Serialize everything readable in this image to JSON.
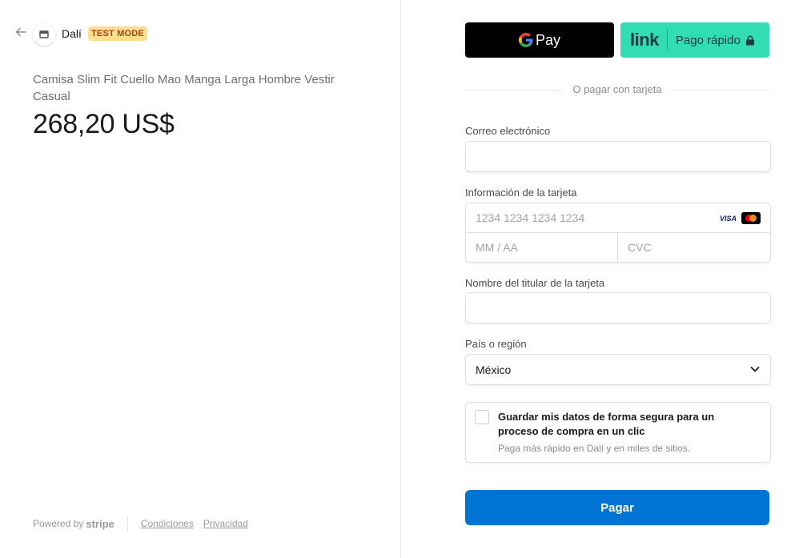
{
  "header": {
    "store_name": "Dalí",
    "badge": "TEST MODE"
  },
  "product": {
    "name": "Camisa Slim Fit Cuello Mao Manga Larga Hombre Vestir Casual",
    "price": "268,20 US$"
  },
  "footer": {
    "powered_by": "Powered by",
    "brand": "stripe",
    "terms": "Condiciones",
    "privacy": "Privacidad"
  },
  "express": {
    "gpay_label": "Pay",
    "link_logo": "link",
    "link_label": "Pago rápido"
  },
  "divider_text": "O pagar con tarjeta",
  "form": {
    "email_label": "Correo electrónico",
    "email_value": "",
    "card_label": "Información de la tarjeta",
    "card_number_placeholder": "1234 1234 1234 1234",
    "card_brand_visa": "VISA",
    "expiry_placeholder": "MM / AA",
    "cvc_placeholder": "CVC",
    "name_label": "Nombre del titular de la tarjeta",
    "name_value": "",
    "country_label": "País o región",
    "country_value": "México",
    "save_title": "Guardar mis datos de forma segura para un proceso de compra en un clic",
    "save_sub": "Paga más rápido en Dalí y en miles de sitios.",
    "pay_label": "Pagar"
  },
  "colors": {
    "pay_button": "#0074d4",
    "link_button": "#33ddb3",
    "badge_bg": "#ffde92",
    "badge_text": "#a2470a"
  },
  "icons": [
    "back-arrow-icon",
    "store-icon",
    "google-g-icon",
    "lock-icon",
    "mastercard-icon",
    "chevron-down-icon"
  ]
}
